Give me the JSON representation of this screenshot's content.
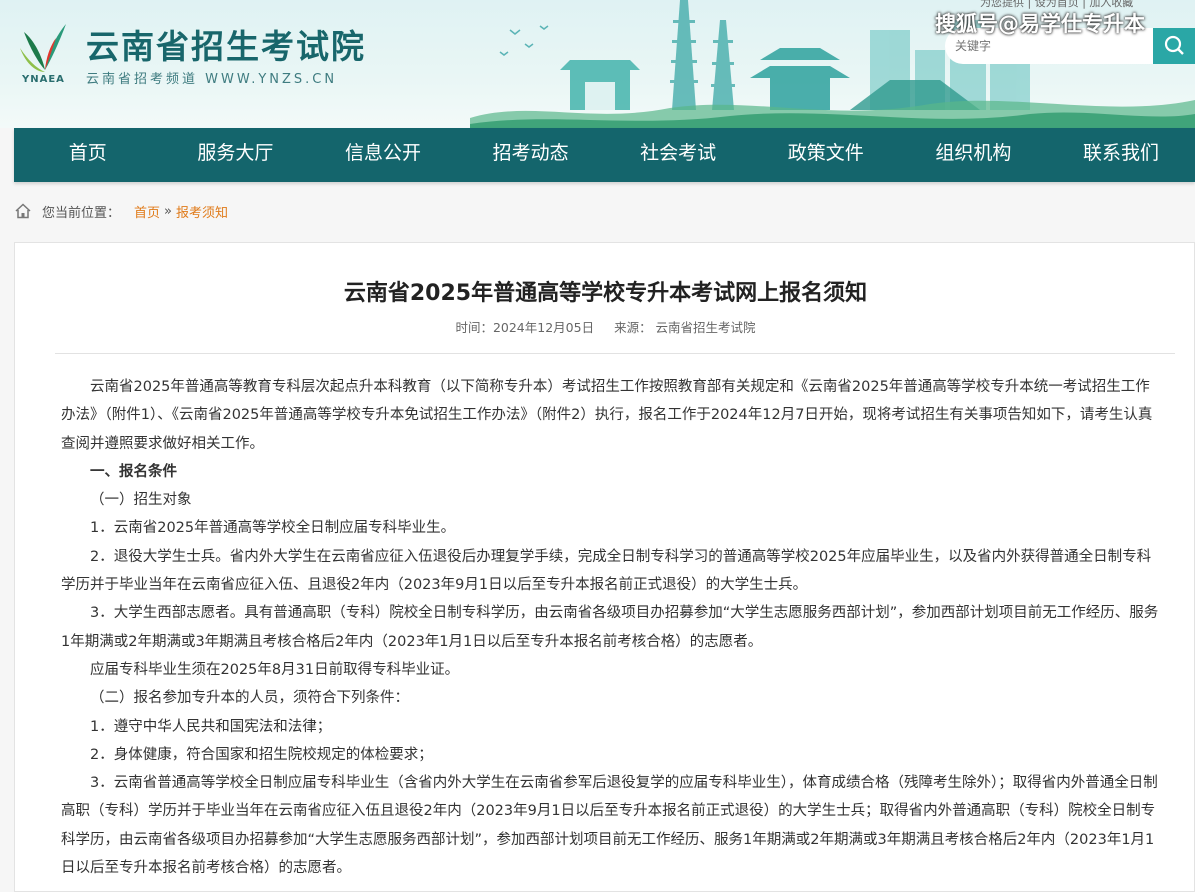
{
  "header": {
    "site_title": "云南省招生考试院",
    "site_sub": "云南省招考频道 WWW.YNZS.CN",
    "logo_en": "YNAEA",
    "top_links": "为您提供 | 设为首页 | 加入收藏",
    "watermark": "搜狐号@易学仕专升本",
    "search_placeholder": "关键字"
  },
  "nav": [
    "首页",
    "服务大厅",
    "信息公开",
    "招考动态",
    "社会考试",
    "政策文件",
    "组织机构",
    "联系我们"
  ],
  "breadcrumb": {
    "label": "您当前位置：",
    "home": "首页",
    "sep": "»",
    "current": "报考须知"
  },
  "article": {
    "title": "云南省2025年普通高等学校专升本考试网上报名须知",
    "time": "时间：2024年12月05日",
    "source": "来源：  云南省招生考试院",
    "paragraphs": [
      "云南省2025年普通高等教育专科层次起点升本科教育（以下简称专升本）考试招生工作按照教育部有关规定和《云南省2025年普通高等学校专升本统一考试招生工作办法》（附件1）、《云南省2025年普通高等学校专升本免试招生工作办法》（附件2）执行，报名工作于2024年12月7日开始，现将考试招生有关事项告知如下，请考生认真查阅并遵照要求做好相关工作。",
      "一、报名条件",
      "（一）招生对象",
      "1．云南省2025年普通高等学校全日制应届专科毕业生。",
      "2．退役大学生士兵。省内外大学生在云南省应征入伍退役后办理复学手续，完成全日制专科学习的普通高等学校2025年应届毕业生，以及省内外获得普通全日制专科学历并于毕业当年在云南省应征入伍、且退役2年内（2023年9月1日以后至专升本报名前正式退役）的大学生士兵。",
      "3．大学生西部志愿者。具有普通高职（专科）院校全日制专科学历，由云南省各级项目办招募参加“大学生志愿服务西部计划”，参加西部计划项目前无工作经历、服务1年期满或2年期满或3年期满且考核合格后2年内（2023年1月1日以后至专升本报名前考核合格）的志愿者。",
      "应届专科毕业生须在2025年8月31日前取得专科毕业证。",
      "（二）报名参加专升本的人员，须符合下列条件：",
      "1．遵守中华人民共和国宪法和法律；",
      "2．身体健康，符合国家和招生院校规定的体检要求；",
      "3．云南省普通高等学校全日制应届专科毕业生（含省内外大学生在云南省参军后退役复学的应届专科毕业生），体育成绩合格（残障考生除外）；取得省内外普通全日制高职（专科）学历并于毕业当年在云南省应征入伍且退役2年内（2023年9月1日以后至专升本报名前正式退役）的大学生士兵；取得省内外普通高职（专科）院校全日制专科学历，由云南省各级项目办招募参加“大学生志愿服务西部计划”，参加西部计划项目前无工作经历、服务1年期满或2年期满或3年期满且考核合格后2年内（2023年1月1日以后至专升本报名前考核合格）的志愿者。"
    ]
  }
}
